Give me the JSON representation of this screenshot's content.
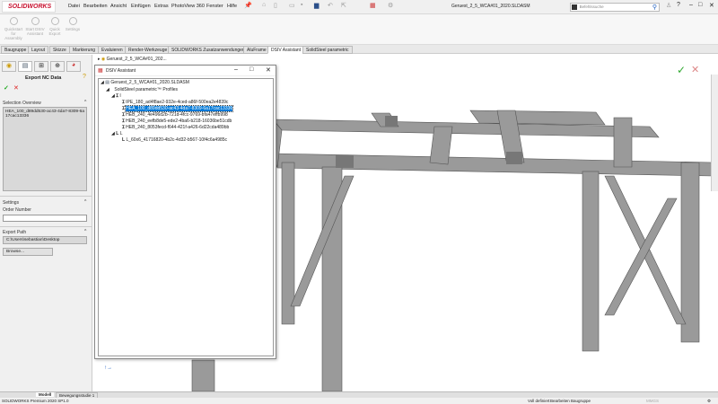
{
  "app": {
    "logo": "SOLIDWORKS",
    "title": "Geruest_2_5_WCA#01_2020.SLDASM",
    "search_placeholder": "Befehlssuche"
  },
  "menu": [
    "Datei",
    "Bearbeiten",
    "Ansicht",
    "Einfügen",
    "Extras",
    "PhotoView 360",
    "Fenster",
    "Hilfe"
  ],
  "ribbon": [
    "Quickstart for Assembly",
    "Start DSIV Assistant",
    "Quick Export",
    "Settings"
  ],
  "tabs": [
    "Baugruppe",
    "Layout",
    "Skizze",
    "Markierung",
    "Evaluieren",
    "Render-Werkzeuge",
    "SOLIDWORKS Zusatzanwendungen",
    "AluFrame",
    "DSIV Assistant",
    "SolidSteel parametric"
  ],
  "active_tab": "DSIV Assistant",
  "panel": {
    "title": "Export NC Data",
    "selection_header": "Selection Overview",
    "selection_value": "HEA_100_d89dd530-ac43-4da7-8309-6a17cac13336",
    "settings_header": "Settings",
    "order_label": "Order Number",
    "order_value": "",
    "export_header": "Export Path",
    "export_value": "C:\\Users\\sebastian\\Desktop",
    "browse": "Browse..."
  },
  "tree_top": "Geruest_2_5_WCA#01_202...",
  "dialog": {
    "title": "DSIV Assistant",
    "root": "Geruest_2_5_WCA#01_2020.SLDASM",
    "group": "SolidSteel parametric™ Profiles",
    "cat_i": "I",
    "items_i": [
      "IPE_180_ad4f8ae2-932e-4ced-a86f-500ea2e4839c",
      "HEA_100_d89dd530-ac43-4da7-8309-6a17cac13336",
      "HEB_240_4e496d2b-721d-4fcc-9769-bfa47effb998",
      "HEB_240_eefb8de5-ede2-4ba6-b218-16036be51cdb",
      "HEB_240_8053fecd-f644-421f-a426-6d22cda489bb"
    ],
    "cat_l": "L",
    "items_l": [
      "L_60x6_41716820-4b2c-4d32-b567-10f4c6a4985c"
    ],
    "selected": 1
  },
  "bottom_tabs": [
    "Modell",
    "Bewegungsstudie 1"
  ],
  "status": {
    "left": "SOLIDWORKS Premium 2020 SP1.0",
    "defined": "Voll definiert",
    "editing": "Bearbeiten Baugruppe",
    "units": "MMGS"
  }
}
